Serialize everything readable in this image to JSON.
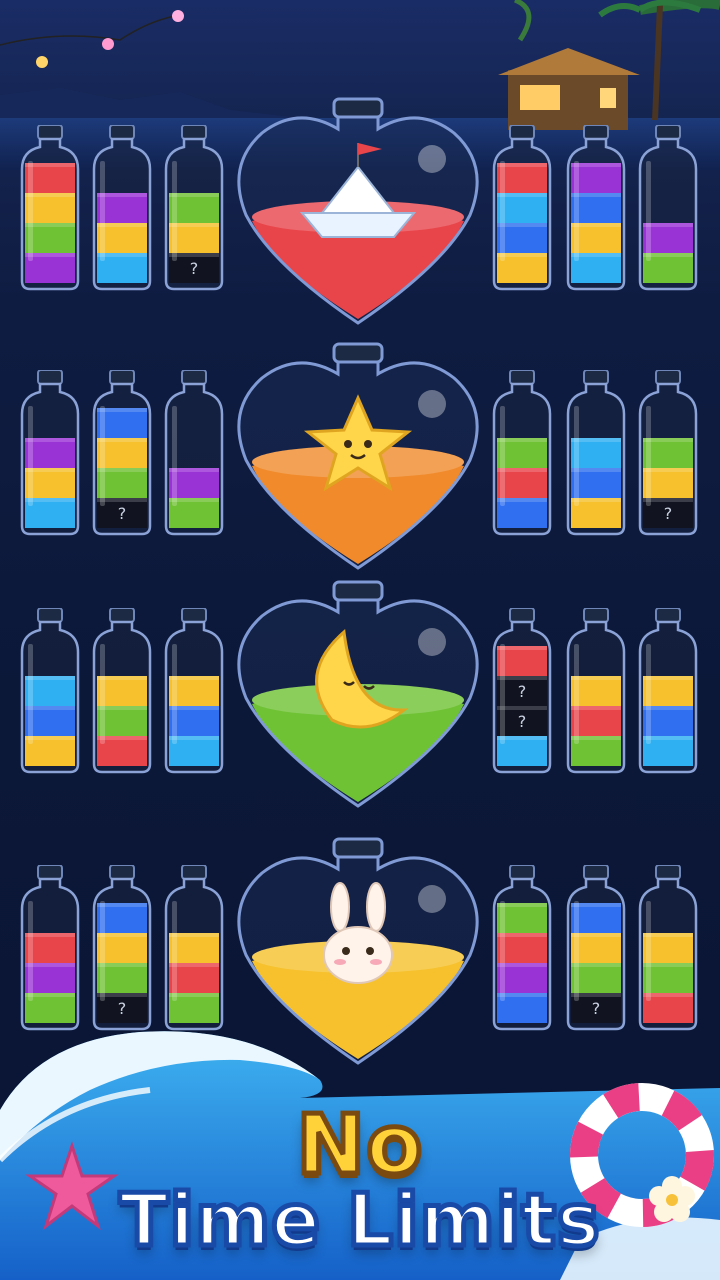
{
  "colors": {
    "red": "#e8454b",
    "yellow": "#f6c12c",
    "green": "#6fc234",
    "purple": "#9a33d6",
    "blue": "#2f6ff0",
    "cyan": "#2fb0f2",
    "orange": "#f08a2a",
    "hidden": "#111420"
  },
  "hidden_label": "?",
  "title": {
    "line1": "No",
    "line2": "Time Limits"
  },
  "rows": [
    {
      "heart": {
        "liquid": "red",
        "mascot": "paper-boat"
      },
      "left": [
        [
          "purple",
          "green",
          "yellow",
          "red"
        ],
        [
          "cyan",
          "yellow",
          "purple"
        ],
        [
          "hidden",
          "yellow",
          "green"
        ]
      ],
      "right": [
        [
          "yellow",
          "blue",
          "cyan",
          "red"
        ],
        [
          "cyan",
          "yellow",
          "blue",
          "purple"
        ],
        [
          "green",
          "purple"
        ]
      ]
    },
    {
      "heart": {
        "liquid": "orange",
        "mascot": "star"
      },
      "left": [
        [
          "cyan",
          "yellow",
          "purple"
        ],
        [
          "hidden",
          "green",
          "yellow",
          "blue"
        ],
        [
          "green",
          "purple"
        ]
      ],
      "right": [
        [
          "blue",
          "red",
          "green"
        ],
        [
          "yellow",
          "blue",
          "cyan"
        ],
        [
          "hidden",
          "yellow",
          "green"
        ]
      ]
    },
    {
      "heart": {
        "liquid": "green",
        "mascot": "moon"
      },
      "left": [
        [
          "yellow",
          "blue",
          "cyan"
        ],
        [
          "red",
          "green",
          "yellow"
        ],
        [
          "cyan",
          "blue",
          "yellow"
        ]
      ],
      "right": [
        [
          "cyan",
          "hidden",
          "hidden",
          "red"
        ],
        [
          "green",
          "red",
          "yellow"
        ],
        [
          "cyan",
          "blue",
          "yellow"
        ]
      ]
    },
    {
      "heart": {
        "liquid": "yellow",
        "mascot": "bunny"
      },
      "left": [
        [
          "green",
          "purple",
          "red"
        ],
        [
          "hidden",
          "green",
          "yellow",
          "blue"
        ],
        [
          "green",
          "red",
          "yellow"
        ]
      ],
      "right": [
        [
          "blue",
          "purple",
          "red",
          "green"
        ],
        [
          "hidden",
          "green",
          "yellow",
          "blue"
        ],
        [
          "red",
          "green",
          "yellow"
        ]
      ]
    }
  ]
}
